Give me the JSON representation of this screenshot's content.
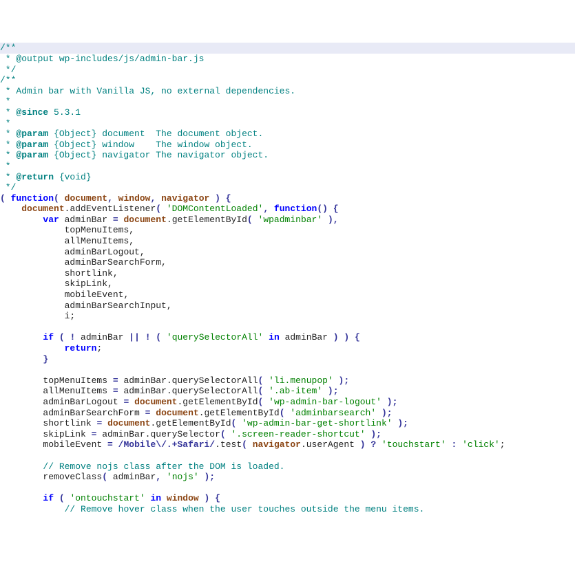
{
  "lines": [
    {
      "hl": true,
      "tokens": [
        {
          "cls": "c-comment",
          "t": "/**"
        }
      ]
    },
    {
      "tokens": [
        {
          "cls": "c-comment",
          "t": " * @output wp-includes/js/admin-bar.js"
        }
      ]
    },
    {
      "tokens": [
        {
          "cls": "c-comment",
          "t": " */"
        }
      ]
    },
    {
      "tokens": [
        {
          "cls": "c-comment",
          "t": "/**"
        }
      ]
    },
    {
      "tokens": [
        {
          "cls": "c-comment",
          "t": " * Admin bar with Vanilla JS, no external dependencies."
        }
      ]
    },
    {
      "tokens": [
        {
          "cls": "c-comment",
          "t": " *"
        }
      ]
    },
    {
      "tokens": [
        {
          "cls": "c-comment",
          "t": " * "
        },
        {
          "cls": "c-tag",
          "t": "@since"
        },
        {
          "cls": "c-comment",
          "t": " 5.3.1"
        }
      ]
    },
    {
      "tokens": [
        {
          "cls": "c-comment",
          "t": " *"
        }
      ]
    },
    {
      "tokens": [
        {
          "cls": "c-comment",
          "t": " * "
        },
        {
          "cls": "c-tag",
          "t": "@param"
        },
        {
          "cls": "c-comment",
          "t": " {Object} document  The document object."
        }
      ]
    },
    {
      "tokens": [
        {
          "cls": "c-comment",
          "t": " * "
        },
        {
          "cls": "c-tag",
          "t": "@param"
        },
        {
          "cls": "c-comment",
          "t": " {Object} window    The window object."
        }
      ]
    },
    {
      "tokens": [
        {
          "cls": "c-comment",
          "t": " * "
        },
        {
          "cls": "c-tag",
          "t": "@param"
        },
        {
          "cls": "c-comment",
          "t": " {Object} navigator The navigator object."
        }
      ]
    },
    {
      "tokens": [
        {
          "cls": "c-comment",
          "t": " *"
        }
      ]
    },
    {
      "tokens": [
        {
          "cls": "c-comment",
          "t": " * "
        },
        {
          "cls": "c-tag",
          "t": "@return"
        },
        {
          "cls": "c-comment",
          "t": " {void}"
        }
      ]
    },
    {
      "tokens": [
        {
          "cls": "c-comment",
          "t": " */"
        }
      ]
    },
    {
      "tokens": [
        {
          "cls": "c-paren",
          "t": "( "
        },
        {
          "cls": "c-keyword",
          "t": "function"
        },
        {
          "cls": "c-paren",
          "t": "( "
        },
        {
          "cls": "c-builtin",
          "t": "document"
        },
        {
          "cls": "c-paren",
          "t": ", "
        },
        {
          "cls": "c-builtin",
          "t": "window"
        },
        {
          "cls": "c-paren",
          "t": ", "
        },
        {
          "cls": "c-builtin",
          "t": "navigator"
        },
        {
          "cls": "c-paren",
          "t": " ) {"
        }
      ]
    },
    {
      "indent": 1,
      "tokens": [
        {
          "cls": "c-builtin",
          "t": "document"
        },
        {
          "cls": "c-ident",
          "t": ".addEventListener"
        },
        {
          "cls": "c-paren",
          "t": "( "
        },
        {
          "cls": "c-string",
          "t": "'DOMContentLoaded'"
        },
        {
          "cls": "c-paren",
          "t": ", "
        },
        {
          "cls": "c-keyword",
          "t": "function"
        },
        {
          "cls": "c-paren",
          "t": "() {"
        }
      ]
    },
    {
      "indent": 2,
      "tokens": [
        {
          "cls": "c-keyword",
          "t": "var"
        },
        {
          "cls": "c-ident",
          "t": " adminBar "
        },
        {
          "cls": "c-op",
          "t": "="
        },
        {
          "cls": "c-ident",
          "t": " "
        },
        {
          "cls": "c-builtin",
          "t": "document"
        },
        {
          "cls": "c-ident",
          "t": ".getElementById"
        },
        {
          "cls": "c-paren",
          "t": "( "
        },
        {
          "cls": "c-string",
          "t": "'wpadminbar'"
        },
        {
          "cls": "c-paren",
          "t": " ),"
        }
      ]
    },
    {
      "indent": 3,
      "tokens": [
        {
          "cls": "c-ident",
          "t": "topMenuItems,"
        }
      ]
    },
    {
      "indent": 3,
      "tokens": [
        {
          "cls": "c-ident",
          "t": "allMenuItems,"
        }
      ]
    },
    {
      "indent": 3,
      "tokens": [
        {
          "cls": "c-ident",
          "t": "adminBarLogout,"
        }
      ]
    },
    {
      "indent": 3,
      "tokens": [
        {
          "cls": "c-ident",
          "t": "adminBarSearchForm,"
        }
      ]
    },
    {
      "indent": 3,
      "tokens": [
        {
          "cls": "c-ident",
          "t": "shortlink,"
        }
      ]
    },
    {
      "indent": 3,
      "tokens": [
        {
          "cls": "c-ident",
          "t": "skipLink,"
        }
      ]
    },
    {
      "indent": 3,
      "tokens": [
        {
          "cls": "c-ident",
          "t": "mobileEvent,"
        }
      ]
    },
    {
      "indent": 3,
      "tokens": [
        {
          "cls": "c-ident",
          "t": "adminBarSearchInput,"
        }
      ]
    },
    {
      "indent": 3,
      "tokens": [
        {
          "cls": "c-ident",
          "t": "i;"
        }
      ]
    },
    {
      "tokens": [
        {
          "cls": "c-ident",
          "t": ""
        }
      ]
    },
    {
      "indent": 2,
      "tokens": [
        {
          "cls": "c-keyword",
          "t": "if"
        },
        {
          "cls": "c-paren",
          "t": " ( "
        },
        {
          "cls": "c-op",
          "t": "!"
        },
        {
          "cls": "c-ident",
          "t": " adminBar "
        },
        {
          "cls": "c-op",
          "t": "||"
        },
        {
          "cls": "c-ident",
          "t": " "
        },
        {
          "cls": "c-op",
          "t": "!"
        },
        {
          "cls": "c-paren",
          "t": " ( "
        },
        {
          "cls": "c-string",
          "t": "'querySelectorAll'"
        },
        {
          "cls": "c-ident",
          "t": " "
        },
        {
          "cls": "c-keyword",
          "t": "in"
        },
        {
          "cls": "c-ident",
          "t": " adminBar "
        },
        {
          "cls": "c-paren",
          "t": ") ) {"
        }
      ]
    },
    {
      "indent": 3,
      "tokens": [
        {
          "cls": "c-keyword",
          "t": "return"
        },
        {
          "cls": "c-ident",
          "t": ";"
        }
      ]
    },
    {
      "indent": 2,
      "tokens": [
        {
          "cls": "c-paren",
          "t": "}"
        }
      ]
    },
    {
      "tokens": [
        {
          "cls": "c-ident",
          "t": ""
        }
      ]
    },
    {
      "indent": 2,
      "tokens": [
        {
          "cls": "c-ident",
          "t": "topMenuItems "
        },
        {
          "cls": "c-op",
          "t": "="
        },
        {
          "cls": "c-ident",
          "t": " adminBar.querySelectorAll"
        },
        {
          "cls": "c-paren",
          "t": "( "
        },
        {
          "cls": "c-string",
          "t": "'li.menupop'"
        },
        {
          "cls": "c-paren",
          "t": " );"
        }
      ]
    },
    {
      "indent": 2,
      "tokens": [
        {
          "cls": "c-ident",
          "t": "allMenuItems "
        },
        {
          "cls": "c-op",
          "t": "="
        },
        {
          "cls": "c-ident",
          "t": " adminBar.querySelectorAll"
        },
        {
          "cls": "c-paren",
          "t": "( "
        },
        {
          "cls": "c-string",
          "t": "'.ab-item'"
        },
        {
          "cls": "c-paren",
          "t": " );"
        }
      ]
    },
    {
      "indent": 2,
      "tokens": [
        {
          "cls": "c-ident",
          "t": "adminBarLogout "
        },
        {
          "cls": "c-op",
          "t": "="
        },
        {
          "cls": "c-ident",
          "t": " "
        },
        {
          "cls": "c-builtin",
          "t": "document"
        },
        {
          "cls": "c-ident",
          "t": ".getElementById"
        },
        {
          "cls": "c-paren",
          "t": "( "
        },
        {
          "cls": "c-string",
          "t": "'wp-admin-bar-logout'"
        },
        {
          "cls": "c-paren",
          "t": " );"
        }
      ]
    },
    {
      "indent": 2,
      "tokens": [
        {
          "cls": "c-ident",
          "t": "adminBarSearchForm "
        },
        {
          "cls": "c-op",
          "t": "="
        },
        {
          "cls": "c-ident",
          "t": " "
        },
        {
          "cls": "c-builtin",
          "t": "document"
        },
        {
          "cls": "c-ident",
          "t": ".getElementById"
        },
        {
          "cls": "c-paren",
          "t": "( "
        },
        {
          "cls": "c-string",
          "t": "'adminbarsearch'"
        },
        {
          "cls": "c-paren",
          "t": " );"
        }
      ]
    },
    {
      "indent": 2,
      "tokens": [
        {
          "cls": "c-ident",
          "t": "shortlink "
        },
        {
          "cls": "c-op",
          "t": "="
        },
        {
          "cls": "c-ident",
          "t": " "
        },
        {
          "cls": "c-builtin",
          "t": "document"
        },
        {
          "cls": "c-ident",
          "t": ".getElementById"
        },
        {
          "cls": "c-paren",
          "t": "( "
        },
        {
          "cls": "c-string",
          "t": "'wp-admin-bar-get-shortlink'"
        },
        {
          "cls": "c-paren",
          "t": " );"
        }
      ]
    },
    {
      "indent": 2,
      "tokens": [
        {
          "cls": "c-ident",
          "t": "skipLink "
        },
        {
          "cls": "c-op",
          "t": "="
        },
        {
          "cls": "c-ident",
          "t": " adminBar.querySelector"
        },
        {
          "cls": "c-paren",
          "t": "( "
        },
        {
          "cls": "c-string",
          "t": "'.screen-reader-shortcut'"
        },
        {
          "cls": "c-paren",
          "t": " );"
        }
      ]
    },
    {
      "indent": 2,
      "tokens": [
        {
          "cls": "c-ident",
          "t": "mobileEvent "
        },
        {
          "cls": "c-op",
          "t": "="
        },
        {
          "cls": "c-ident",
          "t": " "
        },
        {
          "cls": "c-regex",
          "t": "/Mobile\\/.+Safari/"
        },
        {
          "cls": "c-ident",
          "t": ".test"
        },
        {
          "cls": "c-paren",
          "t": "( "
        },
        {
          "cls": "c-builtin",
          "t": "navigator"
        },
        {
          "cls": "c-ident",
          "t": ".userAgent "
        },
        {
          "cls": "c-paren",
          "t": ") "
        },
        {
          "cls": "c-op",
          "t": "?"
        },
        {
          "cls": "c-ident",
          "t": " "
        },
        {
          "cls": "c-string",
          "t": "'touchstart'"
        },
        {
          "cls": "c-ident",
          "t": " "
        },
        {
          "cls": "c-op",
          "t": ":"
        },
        {
          "cls": "c-ident",
          "t": " "
        },
        {
          "cls": "c-string",
          "t": "'click'"
        },
        {
          "cls": "c-ident",
          "t": ";"
        }
      ]
    },
    {
      "tokens": [
        {
          "cls": "c-ident",
          "t": ""
        }
      ]
    },
    {
      "indent": 2,
      "tokens": [
        {
          "cls": "c-comment",
          "t": "// Remove nojs class after the DOM is loaded."
        }
      ]
    },
    {
      "indent": 2,
      "tokens": [
        {
          "cls": "c-ident",
          "t": "removeClass"
        },
        {
          "cls": "c-paren",
          "t": "( "
        },
        {
          "cls": "c-ident",
          "t": "adminBar"
        },
        {
          "cls": "c-paren",
          "t": ", "
        },
        {
          "cls": "c-string",
          "t": "'nojs'"
        },
        {
          "cls": "c-paren",
          "t": " );"
        }
      ]
    },
    {
      "tokens": [
        {
          "cls": "c-ident",
          "t": ""
        }
      ]
    },
    {
      "indent": 2,
      "tokens": [
        {
          "cls": "c-keyword",
          "t": "if"
        },
        {
          "cls": "c-paren",
          "t": " ( "
        },
        {
          "cls": "c-string",
          "t": "'ontouchstart'"
        },
        {
          "cls": "c-ident",
          "t": " "
        },
        {
          "cls": "c-keyword",
          "t": "in"
        },
        {
          "cls": "c-ident",
          "t": " "
        },
        {
          "cls": "c-builtin",
          "t": "window"
        },
        {
          "cls": "c-paren",
          "t": " ) {"
        }
      ]
    },
    {
      "indent": 3,
      "tokens": [
        {
          "cls": "c-comment",
          "t": "// Remove hover class when the user touches outside the menu items."
        }
      ]
    }
  ],
  "indent_unit": "    "
}
